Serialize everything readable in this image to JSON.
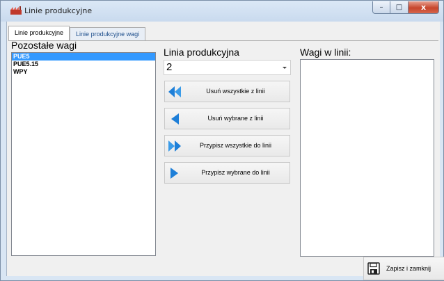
{
  "window": {
    "title": "Linie produkcyjne",
    "close_glyph": "x",
    "minimize_glyph": "–",
    "maximize_glyph": "□"
  },
  "tabs": [
    {
      "label": "Linie produkcyjne",
      "active": true
    },
    {
      "label": "Linie produkcyjne wagi",
      "active": false
    }
  ],
  "left_panel": {
    "label": "Pozostałe wagi",
    "items": [
      {
        "label": "PUE5",
        "selected": true
      },
      {
        "label": "PUE5.15",
        "selected": false
      },
      {
        "label": "WPY",
        "selected": false
      }
    ]
  },
  "middle_panel": {
    "label": "Linia produkcyjna",
    "selected_line": "2",
    "buttons": [
      {
        "label": "Usuń wszystkie z linii",
        "icon": "double-arrow-left-icon"
      },
      {
        "label": "Usuń wybrane z linii",
        "icon": "arrow-left-icon"
      },
      {
        "label": "Przypisz wszystkie do linii",
        "icon": "double-arrow-right-icon"
      },
      {
        "label": "Przypisz wybrane do linii",
        "icon": "arrow-right-icon"
      }
    ]
  },
  "right_panel": {
    "label": "Wagi w linii:"
  },
  "footer": {
    "save_label": "Zapisz i zamknij",
    "save_icon": "floppy-disk-icon"
  },
  "colors": {
    "accent_blue": "#1e7fd8",
    "selection": "#3399ff",
    "close_red": "#c7452c"
  }
}
